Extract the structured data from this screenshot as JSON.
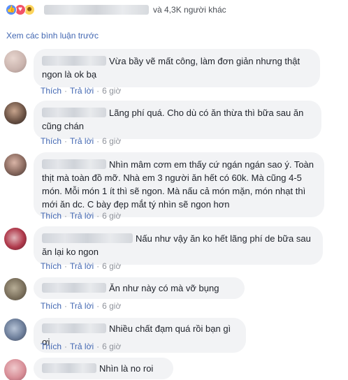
{
  "reactions": {
    "others_text": "và 4,3K người khác"
  },
  "previous_comments_label": "Xem các bình luận trước",
  "actions": {
    "like": "Thích",
    "reply": "Trả lời",
    "separator": "·"
  },
  "comments": [
    {
      "text": "Vừa bầy vẽ mất công, làm đơn giản nhưng thật ngon là ok bạ",
      "time": "6 giờ"
    },
    {
      "text": "Lãng phí quá. Cho dù có ăn thừa thì bữa sau ăn cũng chán",
      "time": "6 giờ"
    },
    {
      "text": "Nhìn mâm cơm em thấy cứ ngán ngán sao ý. Toàn thịt mà toàn đồ mỡ. Nhà em 3 người ăn hết có 60k. Mà cũng 4-5 món. Mỗi món 1 ít thì sẽ ngon. Mà nấu cả món mặn, món nhạt thì mới ăn dc. C bày đẹp mắt tý nhìn sẽ ngon hơn",
      "time": "6 giờ"
    },
    {
      "text": "Nấu như vậy ăn ko hết lãng phí de bữa sau ăn lại ko ngon",
      "time": "6 giờ"
    },
    {
      "text": "Ăn như này có mà vỡ bụng",
      "time": "6 giờ"
    },
    {
      "text": "Nhiều chất đạm quá rồi bạn gì ơi",
      "time": "6 giờ"
    },
    {
      "text": "Nhìn là no roi",
      "time": ""
    }
  ],
  "colors": {
    "link": "#4267b2",
    "bubble": "#f2f3f5",
    "meta": "#90949c",
    "text": "#1d2129"
  }
}
